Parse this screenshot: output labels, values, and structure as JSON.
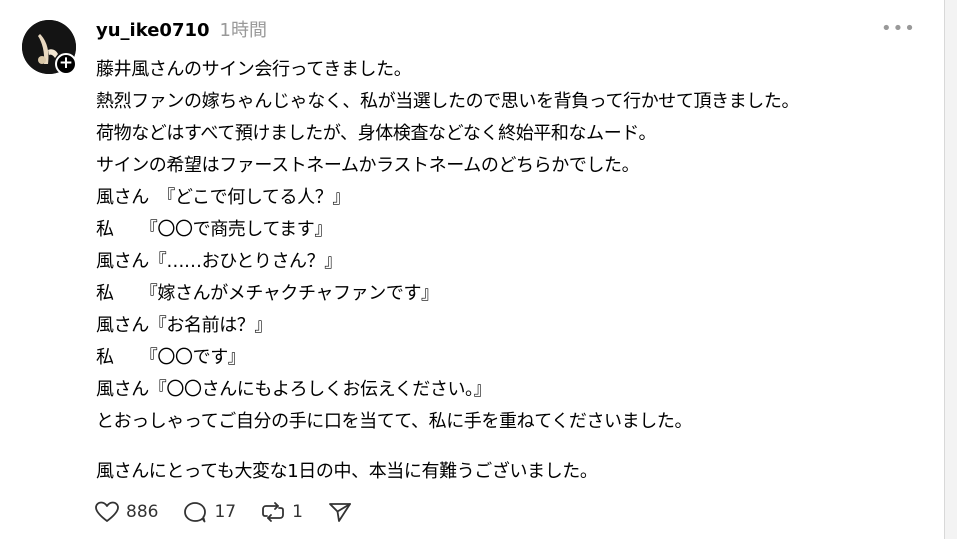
{
  "post": {
    "username": "yu_ike0710",
    "timestamp": "1時間",
    "more_label": "•••",
    "lines": [
      "藤井風さんのサイン会行ってきました。",
      "熱烈ファンの嫁ちゃんじゃなく、私が当選したので思いを背負って行かせて頂きました。",
      "荷物などはすべて預けましたが、身体検査などなく終始平和なムード。",
      "サインの希望はファーストネームかラストネームのどちらかでした。",
      "風さん　『どこで何してる人？』",
      "私　　『〇〇で商売してます』",
      "風さん『……おひとりさん？』",
      "私　　『嫁さんがメチャクチャファンです』",
      "風さん『お名前は？』",
      "私　　『〇〇です』",
      "風さん『〇〇さんにもよろしくお伝えください。』",
      "とおっしゃってご自分の手に口を当てて、私に手を重ねてくださいました。"
    ],
    "closing_line": "風さんにとっても大変な1日の中、本当に有難うございました。"
  },
  "actions": {
    "like_icon": "heart-icon",
    "like_count": "886",
    "reply_icon": "comment-icon",
    "reply_count": "17",
    "repost_icon": "repost-icon",
    "repost_count": "1",
    "share_icon": "send-icon"
  }
}
